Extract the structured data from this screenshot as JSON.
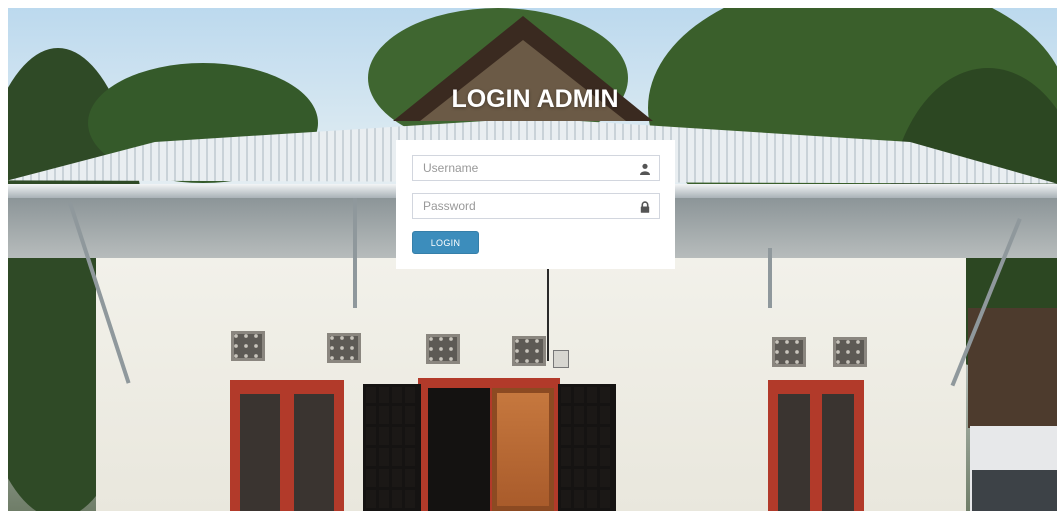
{
  "page": {
    "title": "LOGIN ADMIN"
  },
  "form": {
    "username": {
      "value": "",
      "placeholder": "Username",
      "icon": "user-icon"
    },
    "password": {
      "value": "",
      "placeholder": "Password",
      "icon": "lock-icon"
    },
    "submit_label": "LOGIN"
  },
  "colors": {
    "button": "#3c8dbc",
    "panel": "#ffffff",
    "title_text": "#ffffff"
  }
}
